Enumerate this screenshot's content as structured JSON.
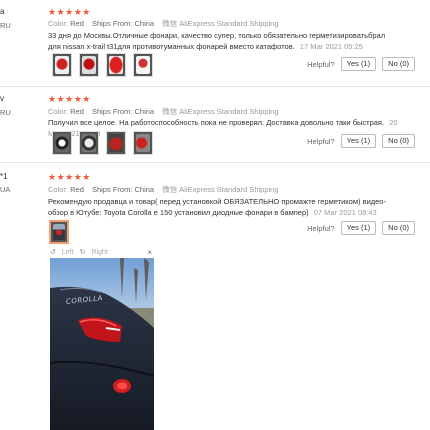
{
  "reviews": [
    {
      "name": "a",
      "country": "RU",
      "stars": "★★★★★",
      "color_label": "Color:",
      "color_value": "Red",
      "ships_label": "Ships From:",
      "ships_value": "China",
      "shipping_code": "微信",
      "shipping_text": "AliExpress Standard Shipping",
      "text": "33 дня до Москвы.Отличные фонари, качество супер, только обязательно герметизироватьбрал для nissan x-trail t31для противотуманных фонарей вместо катафотов.",
      "date": "17 Mar 2021 05:25",
      "helpful_label": "Helpful?",
      "yes_label": "Yes (1)",
      "no_label": "No (0)"
    },
    {
      "name": "v",
      "country": "RU",
      "stars": "★★★★★",
      "color_label": "Color:",
      "color_value": "Red",
      "ships_label": "Ships From:",
      "ships_value": "China",
      "shipping_code": "微信",
      "shipping_text": "AliExpress Standard Shipping",
      "text": "Получил все целое. На работоспособность пока не проверял. Доставка довольно таки быстрая.",
      "date": "20 Mar 2021 09:58",
      "helpful_label": "Helpful?",
      "yes_label": "Yes (1)",
      "no_label": "No (0)"
    },
    {
      "name": "*1",
      "country": "UA",
      "stars": "★★★★★",
      "color_label": "Color:",
      "color_value": "Red",
      "ships_label": "Ships From:",
      "ships_value": "China",
      "shipping_code": "微信",
      "shipping_text": "AliExpress Standard Shipping",
      "text": "Рекомендую продавца и товар( перед установкой ОБЯЗАТЕЛЬНО промажте герметиком) видео-обзор в Ютубе: Toyota Corolla e 150 установил диодные фонари в бампер)",
      "date": "07 Mar 2021 08:43",
      "helpful_label": "Helpful?",
      "yes_label": "Yes (1)",
      "no_label": "No (0)"
    }
  ],
  "viewer": {
    "left_label": "Left",
    "right_label": "Right",
    "close_symbol": "×",
    "car_badge": "COROLLA"
  },
  "colors": {
    "star": "#ee5a3c",
    "accent_border": "#f0a070"
  }
}
